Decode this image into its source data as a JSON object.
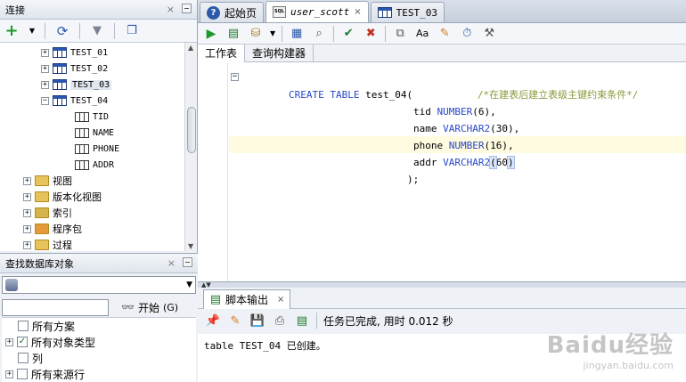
{
  "connections_panel": {
    "title": "连接",
    "tree": [
      {
        "label": "TEST_01"
      },
      {
        "label": "TEST_02"
      },
      {
        "label": "TEST_03"
      },
      {
        "label": "TEST_04"
      },
      {
        "label": "TID"
      },
      {
        "label": "NAME"
      },
      {
        "label": "PHONE"
      },
      {
        "label": "ADDR"
      },
      {
        "label": "视图"
      },
      {
        "label": "版本化视图"
      },
      {
        "label": "索引"
      },
      {
        "label": "程序包"
      },
      {
        "label": "过程"
      }
    ]
  },
  "find_panel": {
    "title": "查找数据库对象",
    "search_value": "",
    "go_label": "开始",
    "go_shortcut": "(G)",
    "options": [
      {
        "label": "所有方案",
        "checked": false
      },
      {
        "label": "所有对象类型",
        "checked": true
      },
      {
        "label": "列",
        "checked": false
      },
      {
        "label": "所有来源行",
        "checked": false
      }
    ]
  },
  "tabs": [
    {
      "label": "起始页"
    },
    {
      "label": "user_scott"
    },
    {
      "label": "TEST_03"
    }
  ],
  "sub_tabs": [
    "工作表",
    "查询构建器"
  ],
  "editor": {
    "lines": [
      {
        "kw1": "CREATE TABLE",
        "text": " test_04(",
        "comment": "/*在建表后建立表级主键约束条件*/"
      },
      {
        "text": "tid ",
        "kw": "NUMBER",
        "rest": "(6),"
      },
      {
        "text": "name ",
        "kw": "VARCHAR2",
        "rest": "(30),"
      },
      {
        "text": "phone ",
        "kw": "NUMBER",
        "rest": "(16),"
      },
      {
        "text": "addr ",
        "kw": "VARCHAR2",
        "rest": "60"
      },
      {
        "text": ");"
      }
    ]
  },
  "output": {
    "tab_label": "脚本输出",
    "status": "任务已完成, 用时 0.012 秒",
    "result": "table TEST_04 已创建。"
  },
  "watermark": {
    "big": "Baidu经验",
    "small": "jingyan.baidu.com"
  },
  "colors": {
    "keyword": "#2848c8",
    "comment": "#8a9a3b",
    "current_line": "#fffbe0"
  }
}
